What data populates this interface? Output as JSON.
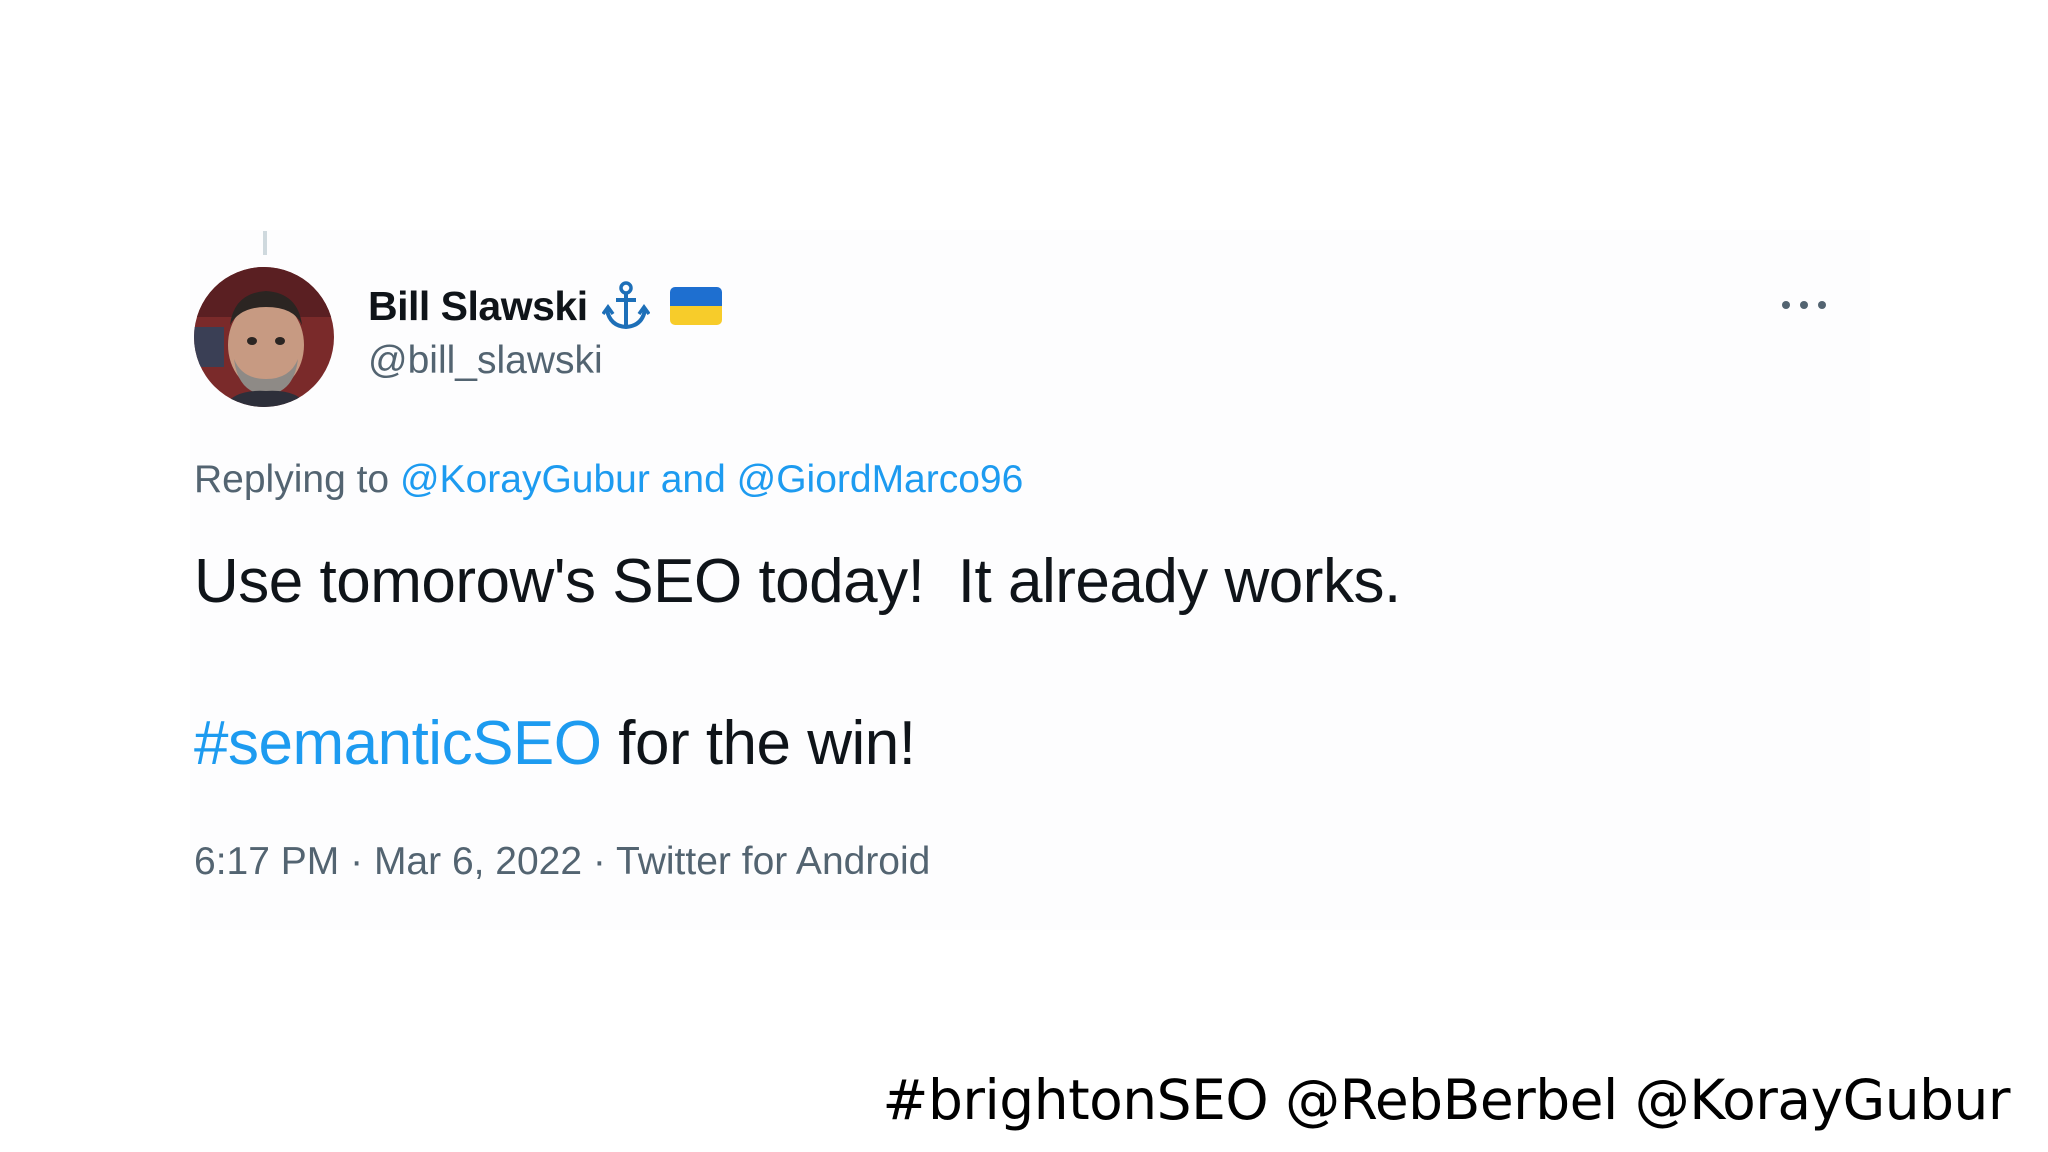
{
  "tweet": {
    "author": {
      "display_name": "Bill Slawski",
      "handle": "@bill_slawski",
      "badges": [
        "anchor-icon",
        "ukraine-flag-icon"
      ]
    },
    "replying_to": {
      "prefix": "Replying to",
      "user1": "@KorayGubur",
      "conjunction": "and",
      "user2": "@GiordMarco96"
    },
    "text_line1": "Use tomorow's SEO today!  It already works.",
    "hashtag": "#semanticSEO",
    "text_line2_rest": " for the win!",
    "time": "6:17 PM",
    "separator": "·",
    "date": "Mar 6, 2022",
    "source": "Twitter for Android",
    "more_icon": "more-horizontal-icon"
  },
  "footer": {
    "text": "#brightonSEO @RebBerbel @KorayGubur"
  },
  "colors": {
    "link": "#1d9bf0",
    "text": "#0f1419",
    "secondary": "#536471",
    "flag_blue": "#1e6fd0",
    "flag_yellow": "#f7cc2a"
  }
}
